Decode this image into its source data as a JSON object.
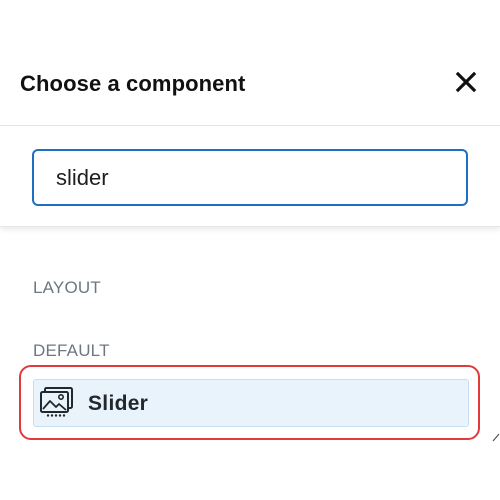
{
  "header": {
    "title": "Choose a component",
    "close_icon": "close-icon"
  },
  "search": {
    "value": "slider",
    "placeholder": ""
  },
  "groups": [
    {
      "label": "LAYOUT"
    },
    {
      "label": "DEFAULT"
    }
  ],
  "results": [
    {
      "label": "Slider",
      "icon": "slider-gallery-icon"
    }
  ],
  "colors": {
    "focus_border": "#1e6fc3",
    "highlight_ring": "#e23a3a",
    "result_bg": "#e8f3fc",
    "group_label": "#6c7781"
  }
}
